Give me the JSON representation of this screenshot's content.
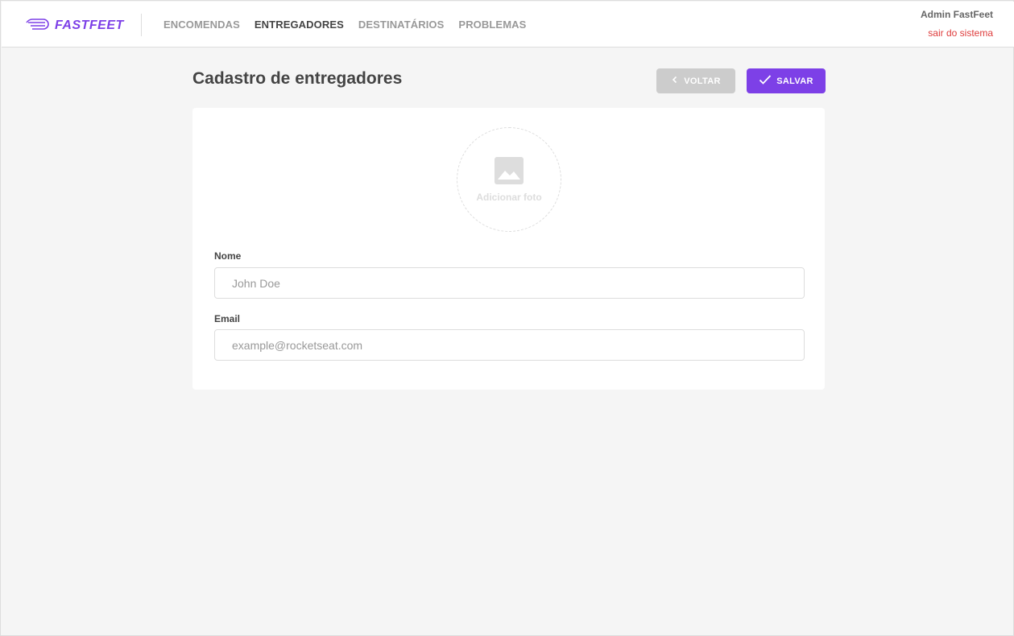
{
  "colors": {
    "brand": "#7d40e7",
    "logout": "#de3b3b"
  },
  "header": {
    "logo_text": "FASTFEET",
    "logo_icon": "truck-speed-icon",
    "nav": [
      {
        "label": "ENCOMENDAS",
        "active": false
      },
      {
        "label": "ENTREGADORES",
        "active": true
      },
      {
        "label": "DESTINATÁRIOS",
        "active": false
      },
      {
        "label": "PROBLEMAS",
        "active": false
      }
    ],
    "user_name": "Admin FastFeet",
    "logout_label": "sair do sistema"
  },
  "main": {
    "title": "Cadastro de entregadores",
    "back_label": "VOLTAR",
    "back_icon": "chevron-left-icon",
    "save_label": "SALVAR",
    "save_icon": "check-icon",
    "avatar": {
      "icon": "image-icon",
      "label": "Adicionar foto"
    },
    "form": {
      "name_label": "Nome",
      "name_placeholder": "John Doe",
      "email_label": "Email",
      "email_placeholder": "example@rocketseat.com"
    }
  }
}
